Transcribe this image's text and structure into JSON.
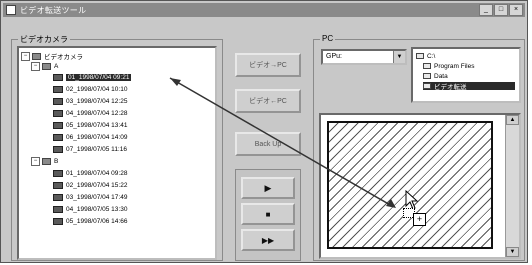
{
  "window": {
    "title": "ビデオ転送ツール"
  },
  "titlebar_buttons": {
    "minimize": "_",
    "maximize": "□",
    "close": "×"
  },
  "left_panel": {
    "label": "ビデオカメラ",
    "root": "ビデオカメラ",
    "folders": [
      {
        "name": "A",
        "items": [
          "01_1998/07/04 09:21",
          "02_1998/07/04 10:10",
          "03_1998/07/04 12:25",
          "04_1998/07/04 12:28",
          "05_1998/07/04 13:41",
          "06_1998/07/04 14:09",
          "07_1998/07/05 11:16"
        ]
      },
      {
        "name": "B",
        "items": [
          "01_1998/07/04 09:28",
          "02_1998/07/04 15:22",
          "03_1998/07/04 17:49",
          "04_1998/07/05 13:30",
          "05_1998/07/06 14:66"
        ]
      }
    ]
  },
  "buttons": {
    "to_pc": "ビデオ→PC",
    "from_pc": "ビデオ←PC",
    "back_up": "Back Up",
    "play": "▶",
    "stop": "■",
    "ff": "▶▶"
  },
  "right_panel": {
    "label": "PC",
    "drive": "GPu:",
    "drop_arrow": "▼",
    "folders": [
      "C:\\",
      "Program Files",
      "Data",
      "ビデオ転送"
    ],
    "selected_folder": "ビデオ転送"
  },
  "drag_cursor": "+",
  "scroll_up": "▲",
  "scroll_down": "▼"
}
